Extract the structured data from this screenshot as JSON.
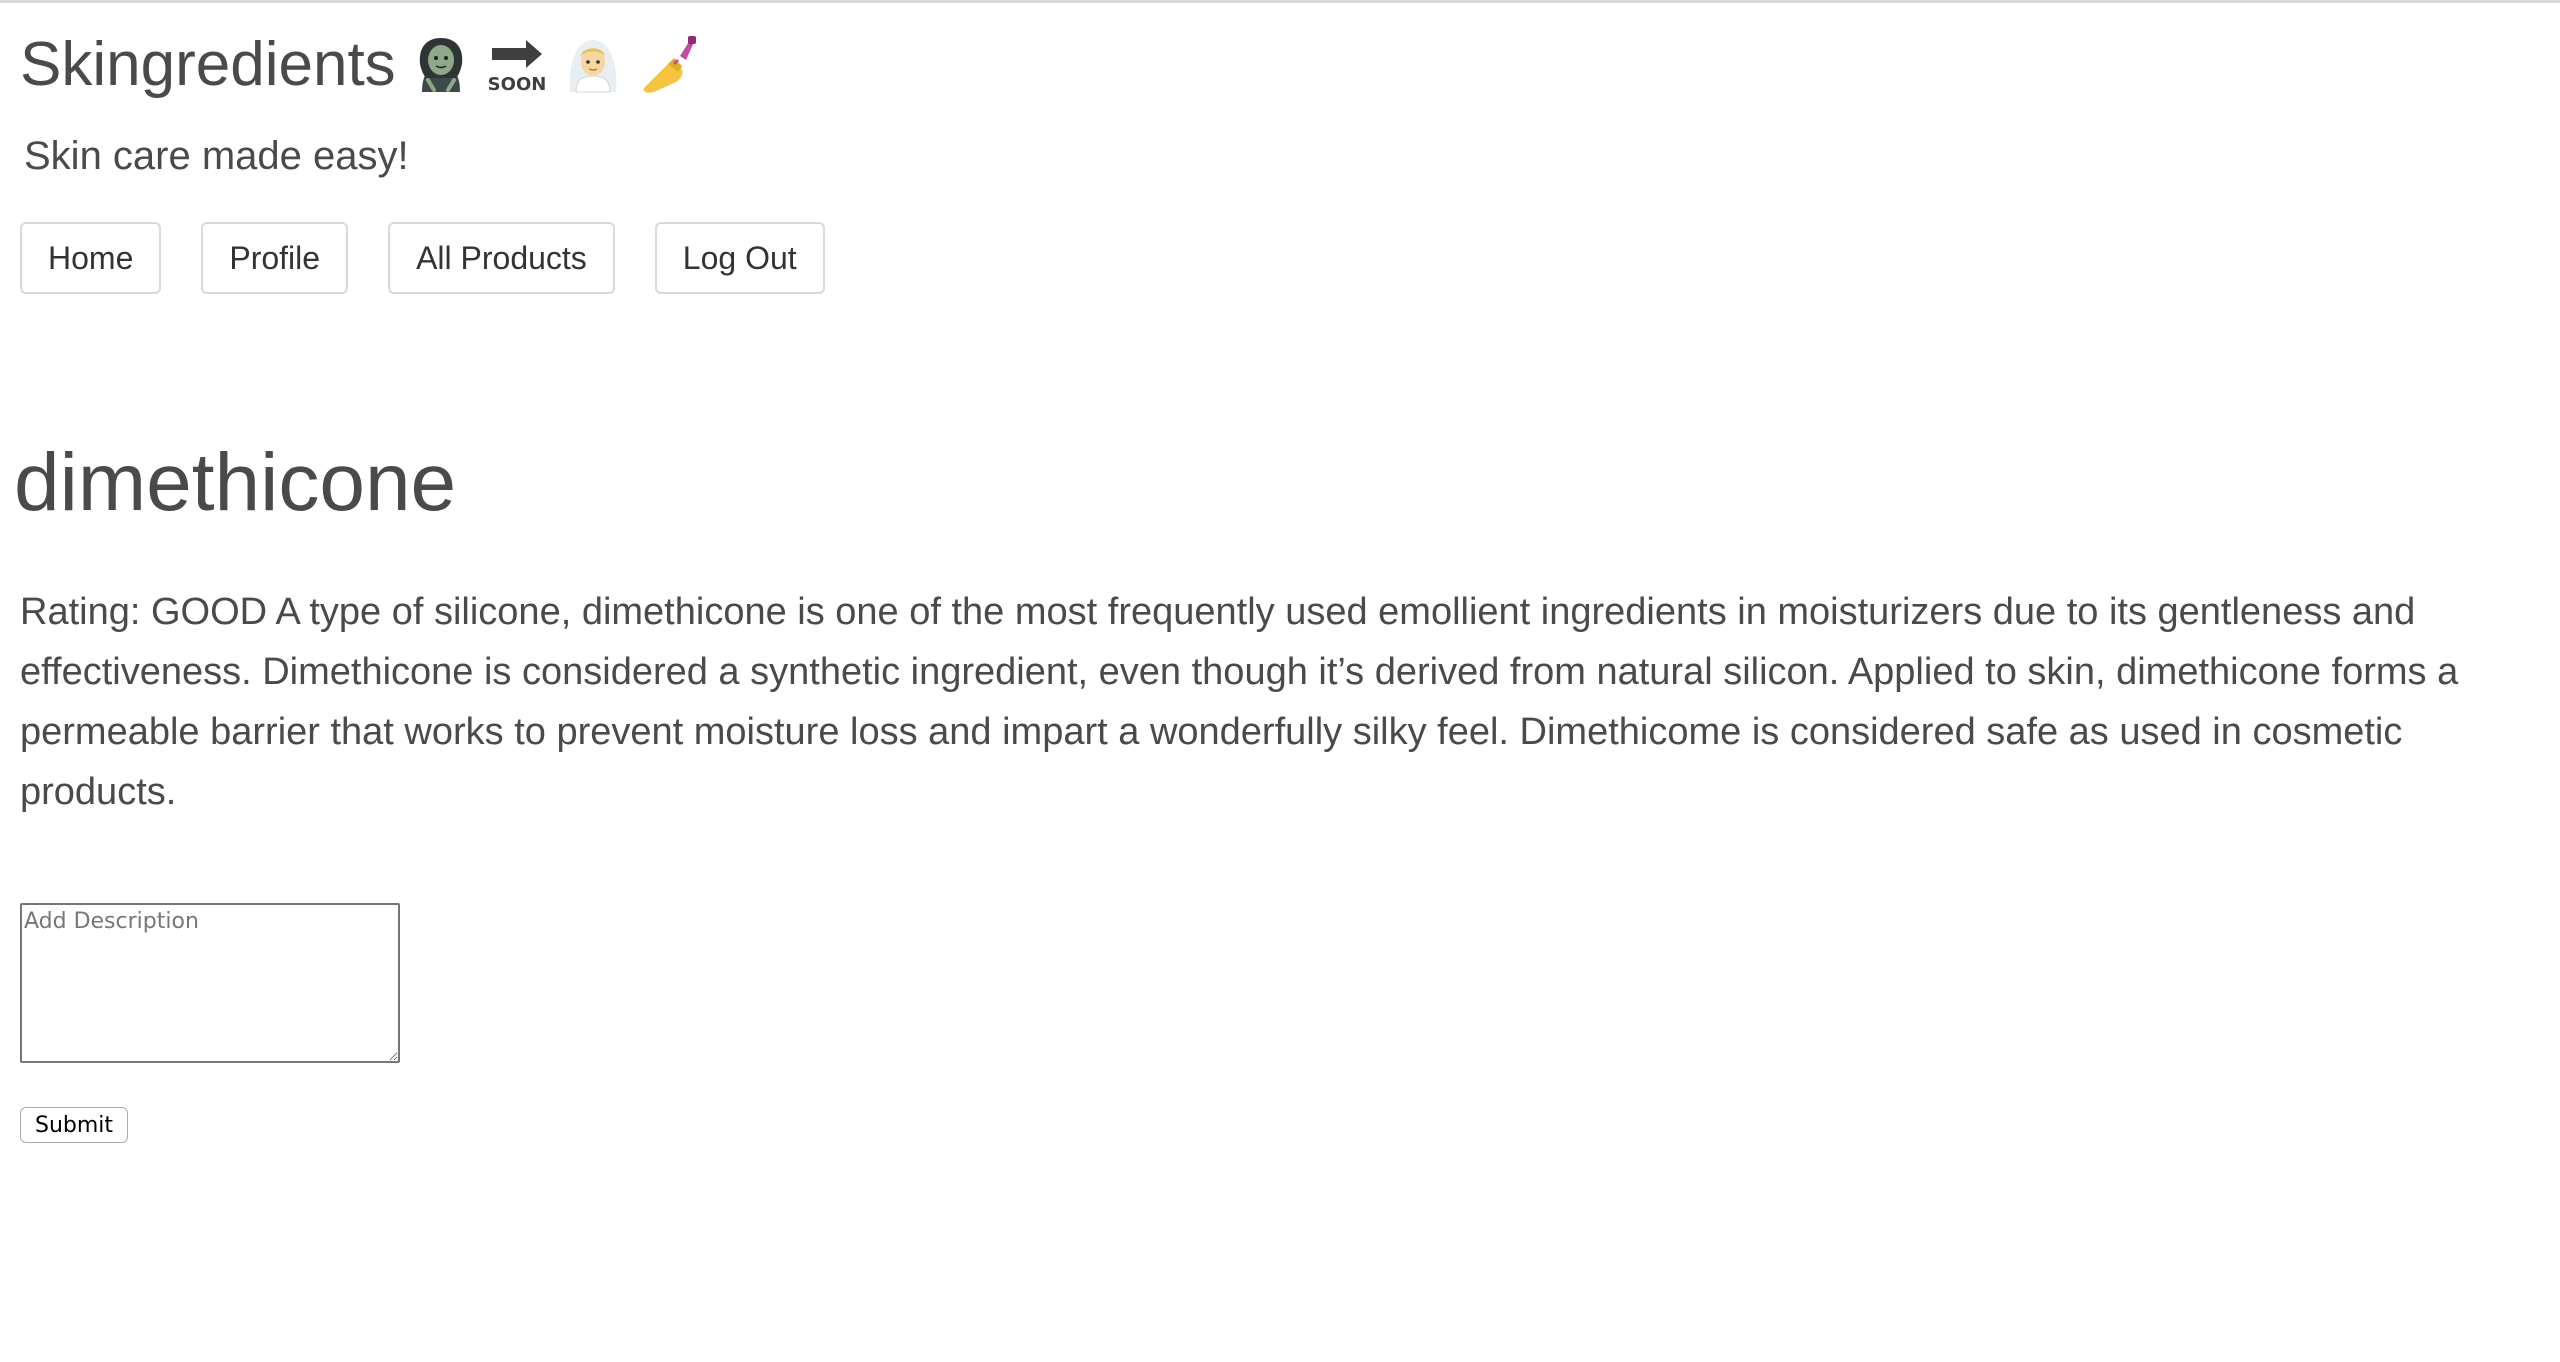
{
  "app": {
    "title": "Skingredients",
    "tagline": "Skin care made easy!",
    "emojis": [
      "zombie-woman-icon",
      "soon-arrow-icon",
      "bride-icon",
      "nail-polish-icon"
    ]
  },
  "nav": {
    "home_label": "Home",
    "profile_label": "Profile",
    "all_products_label": "All Products",
    "log_out_label": "Log Out"
  },
  "ingredient": {
    "name": "dimethicone",
    "description": "Rating: GOOD A type of silicone, dimethicone is one of the most frequently used emollient ingredients in moisturizers due to its gentleness and effectiveness. Dimethicone is considered a synthetic ingredient, even though it’s derived from natural silicon. Applied to skin, dimethicone forms a permeable barrier that works to prevent moisture loss and impart a wonderfully silky feel. Dimethicome is considered safe as used in cosmetic products."
  },
  "form": {
    "description_placeholder": "Add Description",
    "description_value": "",
    "submit_label": "Submit"
  },
  "colors": {
    "text": "#4a4a4a",
    "button_border": "#d9d9d9",
    "background": "#ffffff"
  }
}
